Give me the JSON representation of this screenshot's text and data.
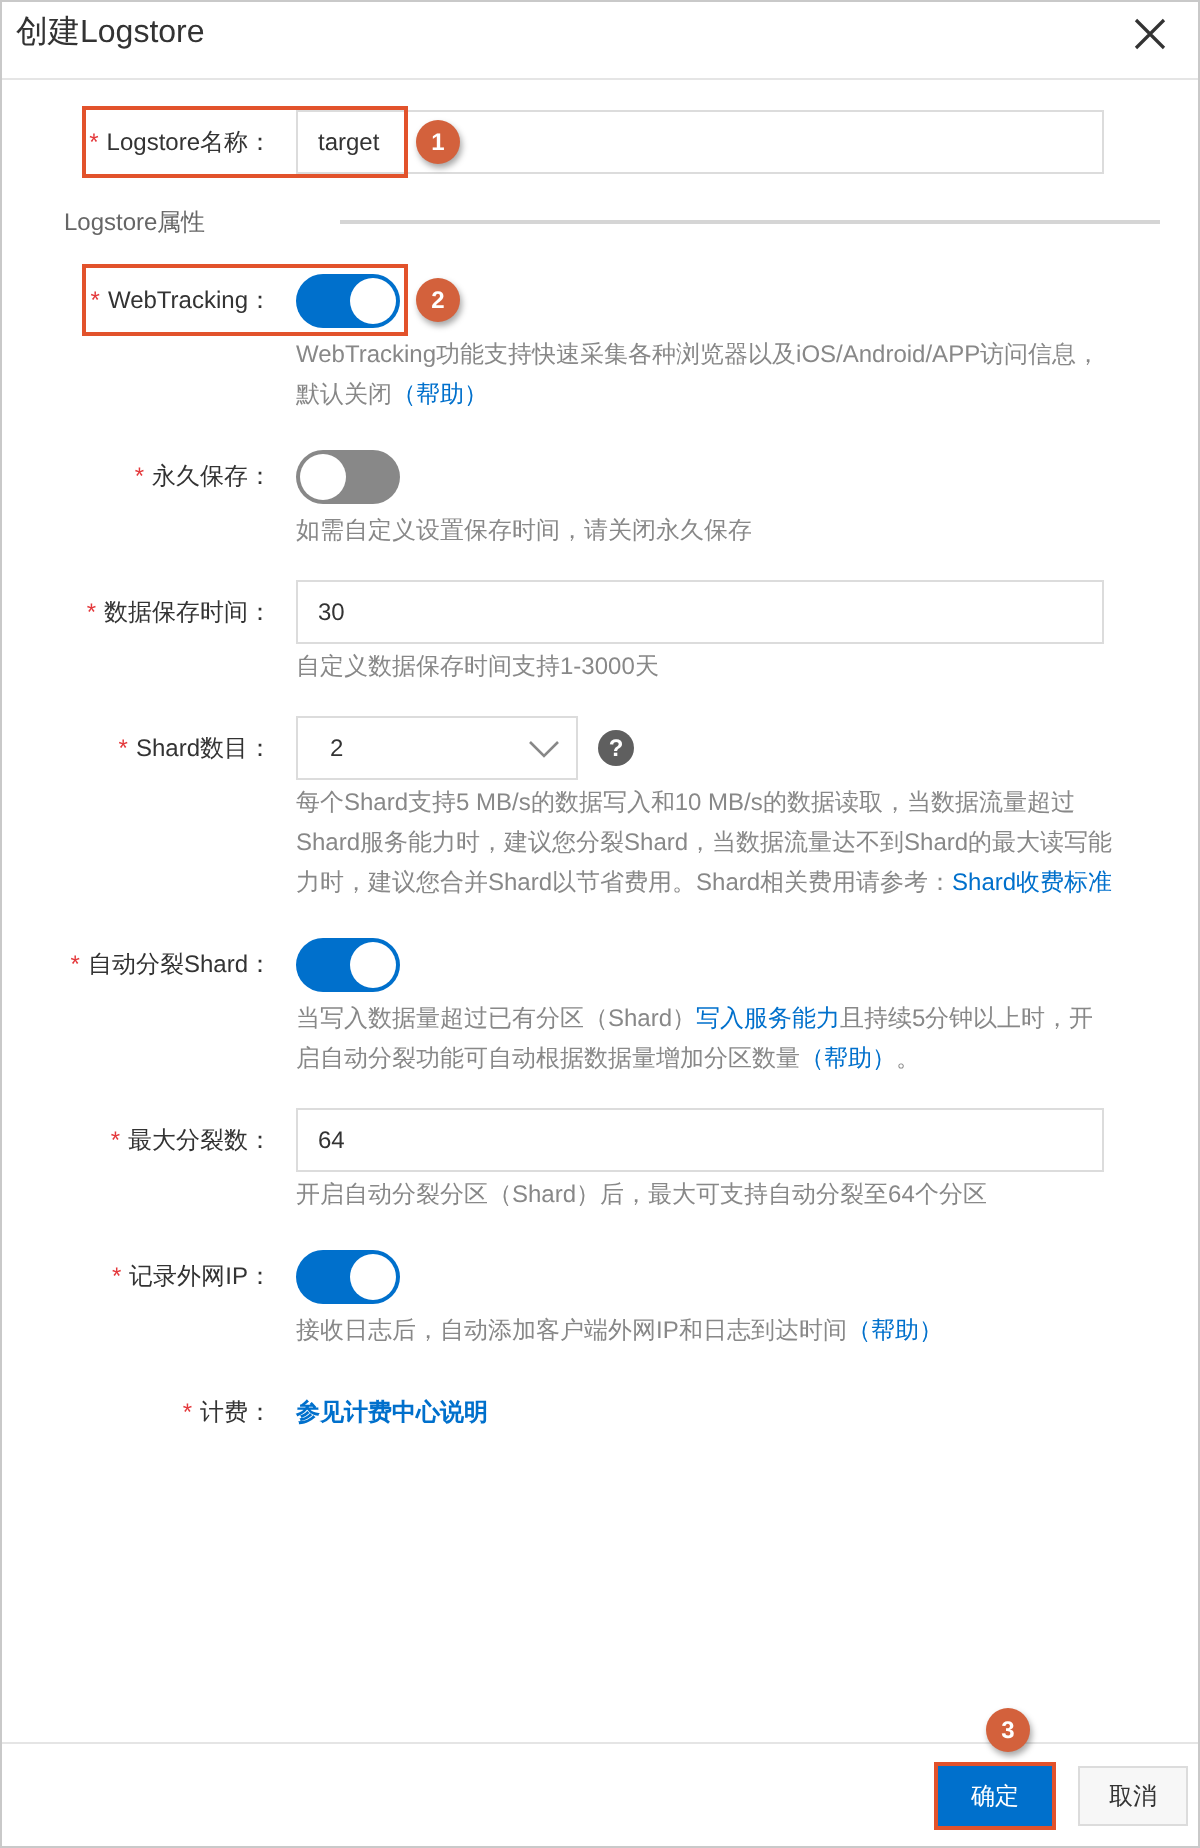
{
  "dialog": {
    "title": "创建Logstore"
  },
  "form": [
    {
      "kind": "input",
      "required_mark": "*",
      "label": "Logstore名称：",
      "value": "target",
      "callout": "1"
    },
    {
      "kind": "section",
      "title": "Logstore属性"
    },
    {
      "kind": "switch",
      "required_mark": "*",
      "label": "WebTracking：",
      "on": true,
      "callout": "2",
      "help": [
        {
          "kind": "text",
          "text": "WebTracking功能支持快速采集各种浏览器以及iOS/Android/APP访问信息，默认关闭"
        },
        {
          "kind": "link",
          "text": "（帮助）"
        }
      ]
    },
    {
      "kind": "switch",
      "required_mark": "*",
      "label": "永久保存：",
      "on": false,
      "help": [
        {
          "kind": "text",
          "text": "如需自定义设置保存时间，请关闭永久保存"
        }
      ]
    },
    {
      "kind": "input",
      "required_mark": "*",
      "label": "数据保存时间：",
      "value": "30",
      "help": [
        {
          "kind": "text",
          "text": "自定义数据保存时间支持1-3000天"
        }
      ]
    },
    {
      "kind": "select",
      "required_mark": "*",
      "label": "Shard数目：",
      "value": "2",
      "hint_icon": "?",
      "help": [
        {
          "kind": "text",
          "text": "每个Shard支持5 MB/s的数据写入和10 MB/s的数据读取，当数据流量超过Shard服务能力时，建议您分裂Shard，当数据流量达不到Shard的最大读写能力时，建议您合并Shard以节省费用。Shard相关费用请参考："
        },
        {
          "kind": "link",
          "text": "Shard收费标准"
        }
      ]
    },
    {
      "kind": "switch",
      "required_mark": "*",
      "label": "自动分裂Shard：",
      "on": true,
      "help": [
        {
          "kind": "text",
          "text": "当写入数据量超过已有分区（Shard）"
        },
        {
          "kind": "link",
          "text": "写入服务能力"
        },
        {
          "kind": "text",
          "text": "且持续5分钟以上时，开启自动分裂功能可自动根据数据量增加分区数量"
        },
        {
          "kind": "link",
          "text": "（帮助）"
        },
        {
          "kind": "text",
          "text": "。"
        }
      ]
    },
    {
      "kind": "input",
      "required_mark": "*",
      "label": "最大分裂数：",
      "value": "64",
      "help": [
        {
          "kind": "text",
          "text": "开启自动分裂分区（Shard）后，最大可支持自动分裂至64个分区"
        }
      ]
    },
    {
      "kind": "switch",
      "required_mark": "*",
      "label": "记录外网IP：",
      "on": true,
      "help": [
        {
          "kind": "text",
          "text": "接收日志后，自动添加客户端外网IP和日志到达时间"
        },
        {
          "kind": "link",
          "text": "（帮助）"
        }
      ]
    },
    {
      "kind": "link",
      "required_mark": "*",
      "label": "计费：",
      "text": "参见计费中心说明"
    }
  ],
  "footer": {
    "buttons": [
      {
        "kind": "primary",
        "label": "确定",
        "callout": "3"
      },
      {
        "kind": "default",
        "label": "取消"
      }
    ]
  }
}
